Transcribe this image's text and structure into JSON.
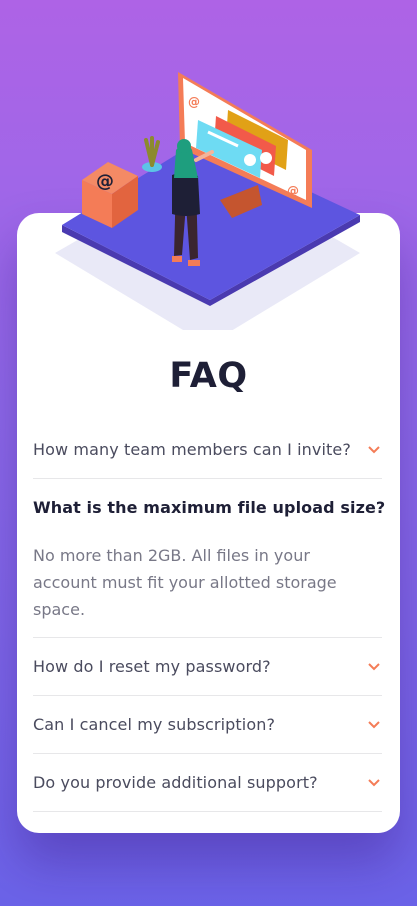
{
  "page": {
    "title": "FAQ"
  },
  "faq": {
    "items": [
      {
        "question": "How many team members can I invite?",
        "open": false
      },
      {
        "question": "What is the maximum file upload size?",
        "open": true,
        "answer": "No more than 2GB. All files in your account must fit your allotted storage space."
      },
      {
        "question": "How do I reset my password?",
        "open": false
      },
      {
        "question": "Can I cancel my subscription?",
        "open": false
      },
      {
        "question": "Do you provide additional support?",
        "open": false
      }
    ]
  },
  "illustration": {
    "name": "woman-at-online-monitor",
    "box_symbol": "@"
  },
  "colors": {
    "bg_top": "#ae63e6",
    "bg_bottom": "#6b63e8",
    "accent": "#f47c57",
    "title": "#1e1f36",
    "text": "#4a4b5e",
    "answer": "#787887"
  }
}
